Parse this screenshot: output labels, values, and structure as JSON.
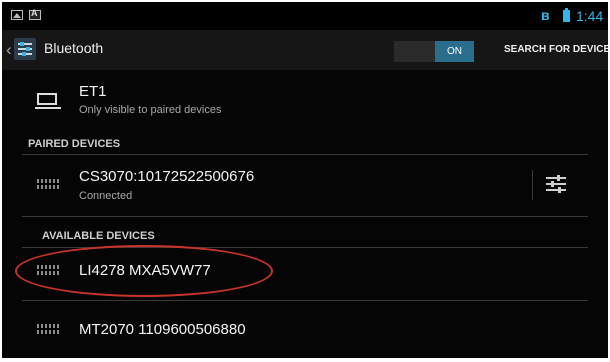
{
  "status_bar": {
    "time": "1:44",
    "icons": [
      "image-icon",
      "app-icon",
      "bluetooth-icon",
      "battery-icon"
    ],
    "accent": "#33b5e5"
  },
  "action_bar": {
    "title": "Bluetooth",
    "toggle_label": "ON",
    "search_label": "SEARCH FOR DEVICES"
  },
  "this_device": {
    "name": "ET1",
    "visibility": "Only visible to paired devices",
    "icon": "laptop-icon"
  },
  "paired": {
    "header": "PAIRED DEVICES",
    "items": [
      {
        "name": "CS3070:10172522500676",
        "status": "Connected",
        "icon": "keyboard-icon",
        "settings_icon": "tune-icon"
      }
    ]
  },
  "available": {
    "header": "AVAILABLE DEVICES",
    "items": [
      {
        "name": "LI4278 MXA5VW77",
        "icon": "keyboard-icon",
        "highlighted": true
      },
      {
        "name": "MT2070 1109600506880",
        "icon": "keyboard-icon"
      }
    ]
  },
  "colors": {
    "background": "#050505",
    "toggle_on": "#2a6e8e",
    "highlight": "#c9342a"
  }
}
